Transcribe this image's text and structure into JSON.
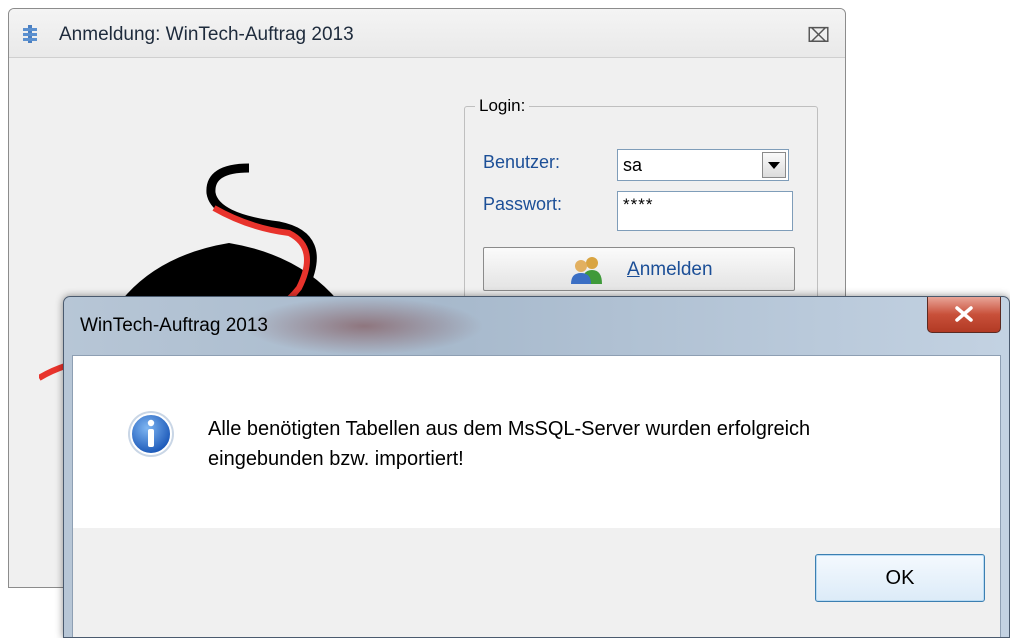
{
  "login_window": {
    "title": "Anmeldung: WinTech-Auftrag 2013",
    "close_glyph": "⌧",
    "group_label": "Login:",
    "user_label": "Benutzer:",
    "user_value": "sa",
    "password_label": "Passwort:",
    "password_value": "****",
    "login_button_label_mnemonic": "A",
    "login_button_label_rest": "nmelden",
    "colors": {
      "label_text": "#1c4f97",
      "logo_red": "#e8332c",
      "logo_black": "#000000"
    }
  },
  "message_box": {
    "title": "WinTech-Auftrag 2013",
    "message_line1": "Alle benötigten Tabellen aus dem MsSQL-Server wurden erfolgreich",
    "message_line2": "eingebunden bzw. importiert!",
    "ok_label": "OK",
    "icon": "info-icon",
    "colors": {
      "close_button": "#c8503a"
    }
  }
}
